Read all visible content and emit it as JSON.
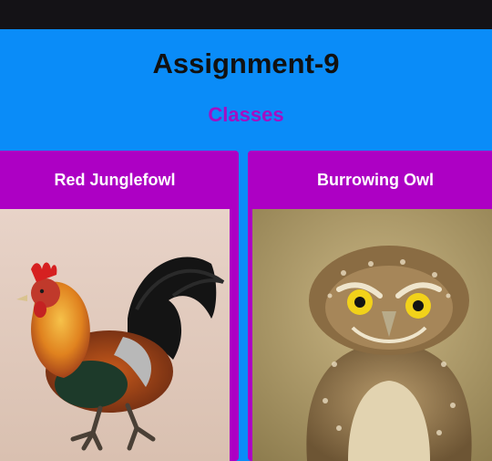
{
  "page": {
    "title": "Assignment-9",
    "section_title": "Classes"
  },
  "cards": [
    {
      "title": "Red Junglefowl",
      "image": "red-junglefowl-photo"
    },
    {
      "title": "Burrowing Owl",
      "image": "burrowing-owl-photo"
    }
  ],
  "colors": {
    "background": "#0a8cf8",
    "topbar": "#141216",
    "card": "#ad00c4",
    "section_title": "#a30fc2"
  }
}
